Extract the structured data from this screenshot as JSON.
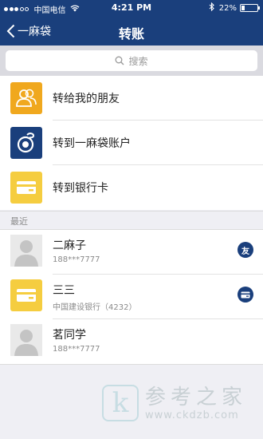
{
  "status_bar": {
    "carrier": "中国电信",
    "time": "4:21 PM",
    "battery_percent": "22%",
    "battery_level": 0.22
  },
  "nav": {
    "back_label": "一麻袋",
    "title": "转账"
  },
  "search": {
    "placeholder": "搜索"
  },
  "menu": {
    "items": [
      {
        "label": "转给我的朋友",
        "icon": "friends-icon",
        "color": "#f0a81e"
      },
      {
        "label": "转到一麻袋账户",
        "icon": "yimadai-logo-icon",
        "color": "#1a3f7c"
      },
      {
        "label": "转到银行卡",
        "icon": "bank-card-icon",
        "color": "#f5cd40"
      }
    ]
  },
  "recent": {
    "header": "最近",
    "items": [
      {
        "name": "二麻子",
        "sub": "188***7777",
        "icon": "default-avatar-icon",
        "badge_icon": "friend-badge-icon",
        "badge_text": "友"
      },
      {
        "name": "三三",
        "sub": "中国建设银行（4232）",
        "icon": "bank-card-icon",
        "badge_icon": "card-badge-icon",
        "badge_text": ""
      },
      {
        "name": "茗同学",
        "sub": "188***7777",
        "icon": "default-avatar-icon",
        "badge_icon": "",
        "badge_text": ""
      }
    ]
  },
  "watermark": {
    "logo_letter": "k",
    "chinese": "参考之家",
    "url": "www.ckdzb.com"
  },
  "colors": {
    "primary": "#1a3f7c",
    "orange": "#f0a81e",
    "yellow": "#f5cd40",
    "background": "#efeff4"
  }
}
